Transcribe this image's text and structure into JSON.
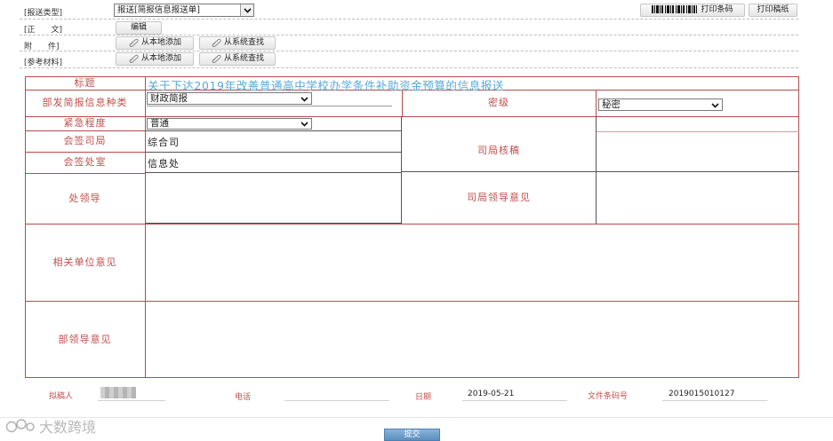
{
  "header": {
    "report_type_label": "[报送类型]",
    "report_type_value": "报送[简报信息报送单]",
    "barcode_button": "打印条码",
    "draft_button": "打印稿纸",
    "body_label": "[正　　文]",
    "edit_button": "编辑",
    "attachment_label": "附　　件]",
    "reference_label": "[参考材料]",
    "add_local": "从本地添加",
    "find_system": "从系统查找"
  },
  "form": {
    "title_label": "标题",
    "title_value": "关于下达2019年改善普通高中学校办学条件补助资金预算的信息报送",
    "category_label": "部发简报信息种类",
    "category_value": "财政简报",
    "secrecy_label": "密级",
    "secrecy_value": "秘密",
    "urgency_label": "紧急程度",
    "urgency_value": "普通",
    "cosign_dept_label": "会签司局",
    "cosign_dept_value": "综合司",
    "cosign_office_label": "会签处室",
    "cosign_office_value": "信息处",
    "dept_review_label": "司局核稿",
    "section_leader_label": "处领导",
    "dept_leader_label": "司局领导意见",
    "related_units_label": "相关单位意见",
    "ministry_leader_label": "部领导意见"
  },
  "footer": {
    "drafter_label": "拟稿人",
    "phone_label": "电话",
    "date_label": "日期",
    "date_value": "2019-05-21",
    "barcode_label": "文件条码号",
    "barcode_value": "2019015010127",
    "submit_label": "提交"
  },
  "watermark": "大数跨境",
  "colors": {
    "label_red": "#c0504d",
    "border_red": "#b84a4a",
    "title_blue": "#5aa9d6",
    "submit_blue": "#5b8fbf"
  }
}
